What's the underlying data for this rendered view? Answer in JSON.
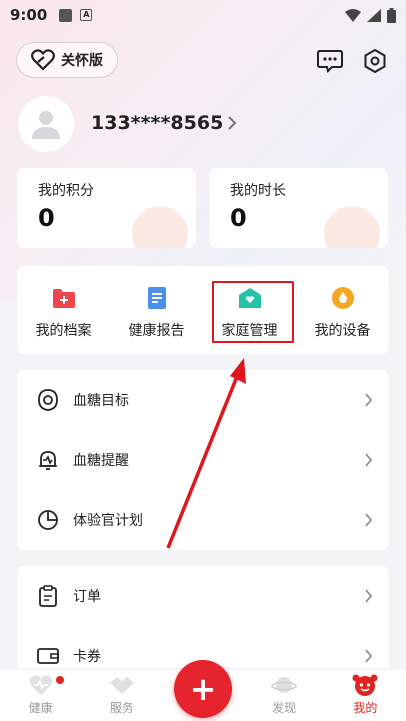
{
  "status_bar": {
    "time": "9:00",
    "a_icon": "A"
  },
  "header": {
    "care_label": "关怀版"
  },
  "profile": {
    "phone": "133****8565"
  },
  "stats": [
    {
      "label": "我的积分",
      "value": "0"
    },
    {
      "label": "我的时长",
      "value": "0"
    }
  ],
  "quick": [
    {
      "label": "我的档案",
      "icon": "folder-plus-icon",
      "color": "#f0444c"
    },
    {
      "label": "健康报告",
      "icon": "report-icon",
      "color": "#4a90e8"
    },
    {
      "label": "家庭管理",
      "icon": "home-heart-icon",
      "color": "#22c3a6"
    },
    {
      "label": "我的设备",
      "icon": "device-icon",
      "color": "#f5a623"
    }
  ],
  "list1": [
    {
      "label": "血糖目标",
      "icon": "target-icon"
    },
    {
      "label": "血糖提醒",
      "icon": "alarm-bell-icon"
    },
    {
      "label": "体验官计划",
      "icon": "pie-chart-icon"
    }
  ],
  "list2": [
    {
      "label": "订单",
      "icon": "clipboard-icon"
    },
    {
      "label": "卡券",
      "icon": "wallet-icon"
    }
  ],
  "tabs": [
    {
      "label": "健康"
    },
    {
      "label": "服务"
    },
    {
      "label": "发现"
    },
    {
      "label": "我的"
    }
  ],
  "fab": {
    "label": "+"
  },
  "colors": {
    "accent": "#e5242e",
    "highlight": "#e0161d"
  }
}
